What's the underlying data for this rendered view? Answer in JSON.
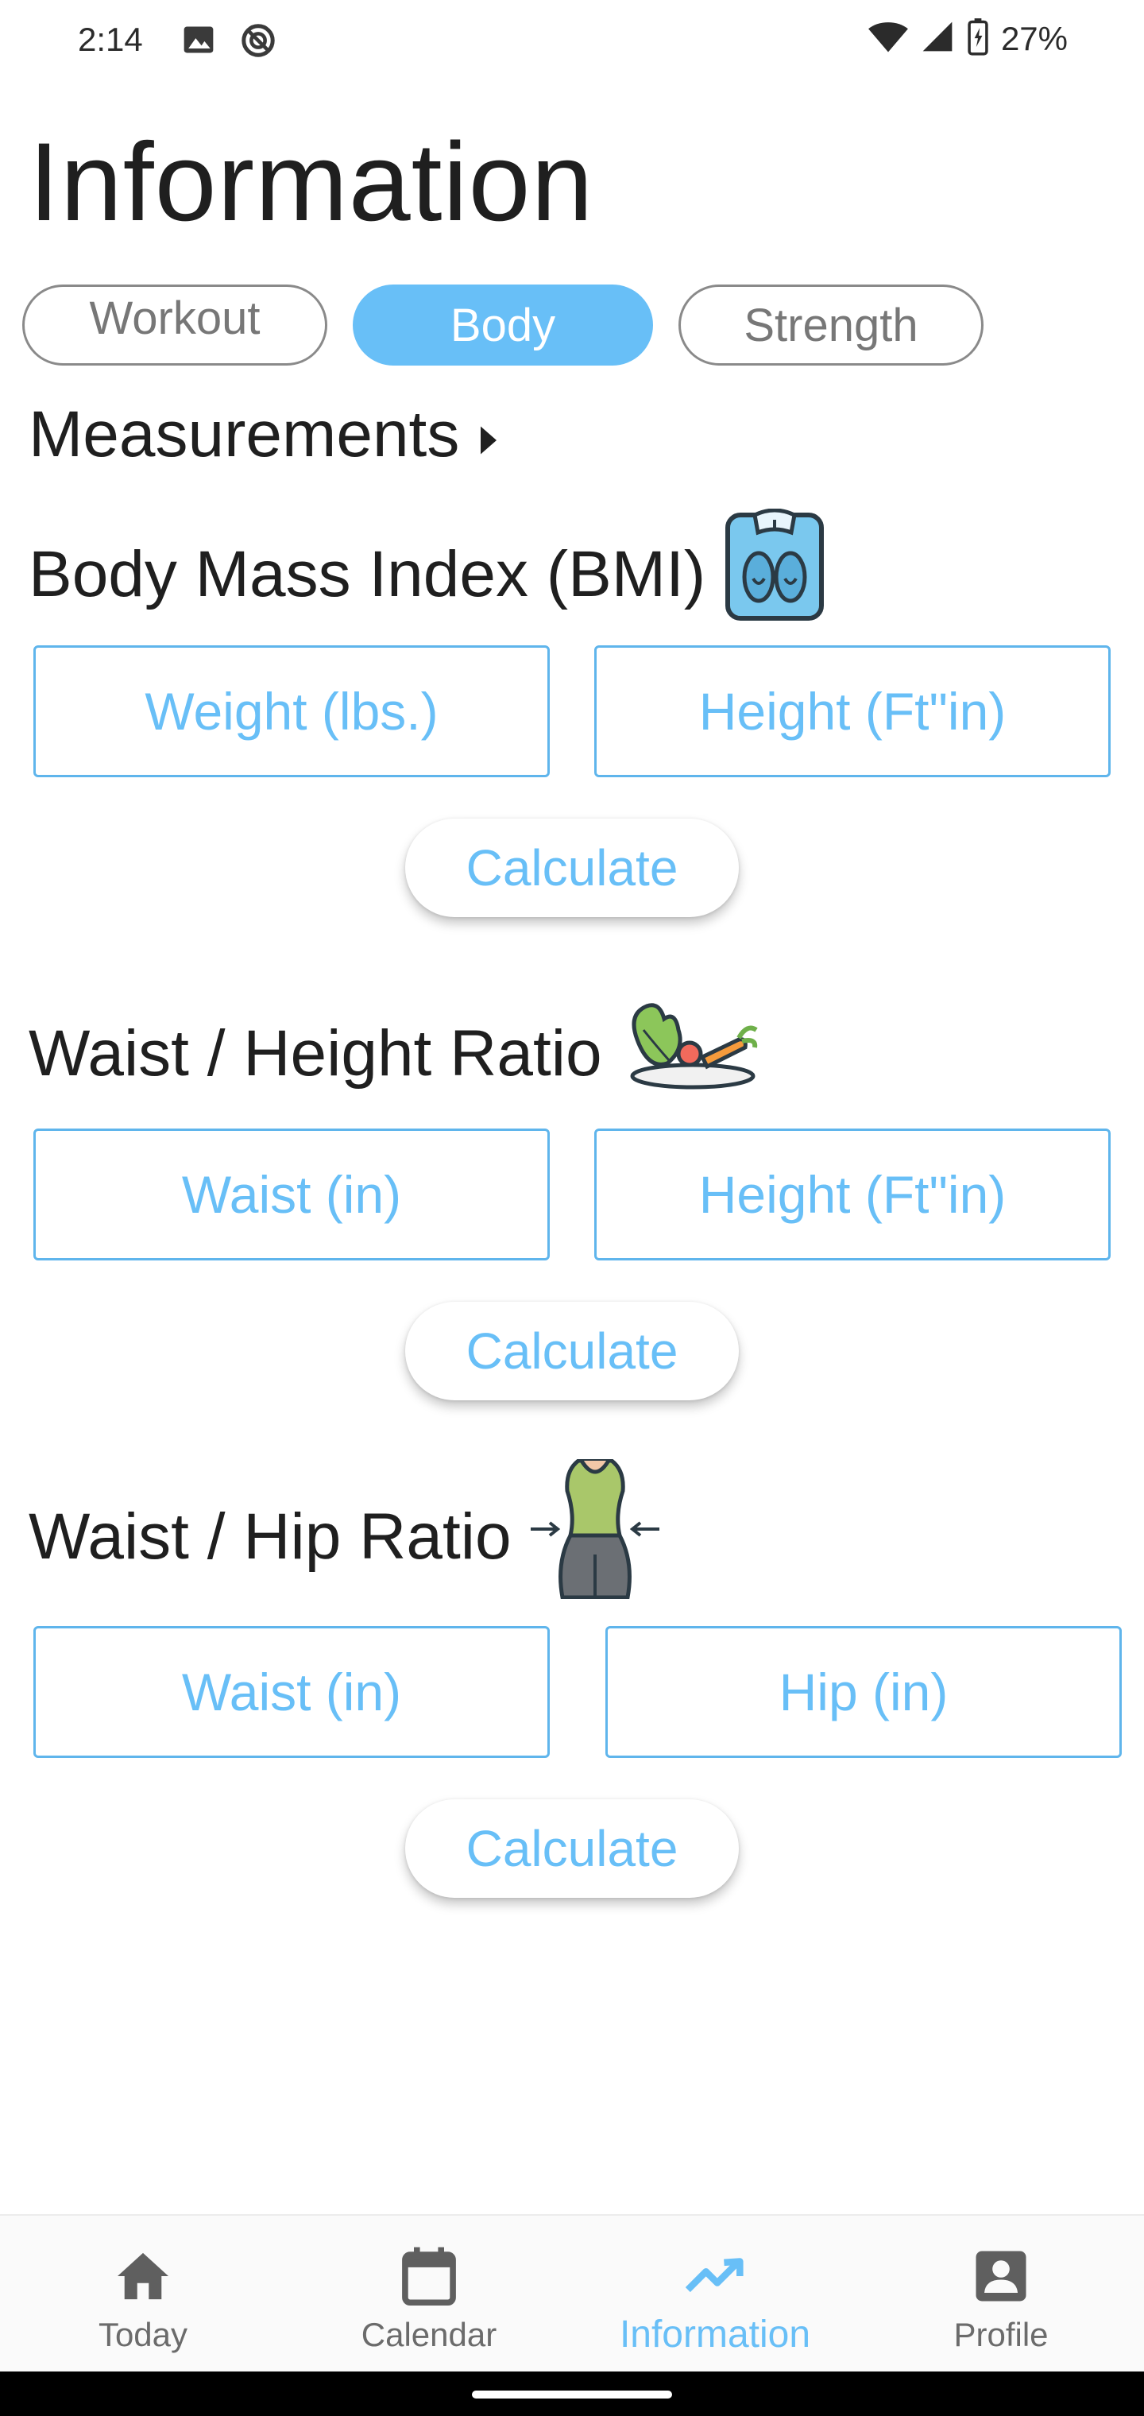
{
  "status_bar": {
    "time": "2:14",
    "battery": "27%",
    "icons": [
      "image-icon",
      "do-not-disturb-icon",
      "wifi-icon",
      "signal-icon",
      "battery-charging-icon"
    ]
  },
  "page": {
    "title": "Information"
  },
  "tabs": [
    {
      "label": "Workout",
      "active": false
    },
    {
      "label": "Body",
      "active": true
    },
    {
      "label": "Strength",
      "active": false
    }
  ],
  "measurements": {
    "label": "Measurements",
    "icon": "caret-right-icon"
  },
  "sections": {
    "bmi": {
      "title": "Body Mass Index (BMI)",
      "icon": "scale-icon",
      "fields": [
        {
          "placeholder": "Weight (lbs.)"
        },
        {
          "placeholder": "Height (Ft\"in)"
        }
      ],
      "button": "Calculate"
    },
    "waist_height": {
      "title": "Waist / Height Ratio",
      "icon": "salad-plate-icon",
      "fields": [
        {
          "placeholder": "Waist (in)"
        },
        {
          "placeholder": "Height (Ft\"in)"
        }
      ],
      "button": "Calculate"
    },
    "waist_hip": {
      "title": "Waist / Hip Ratio",
      "icon": "waist-torso-icon",
      "fields": [
        {
          "placeholder": "Waist (in)"
        },
        {
          "placeholder": "Hip (in)"
        }
      ],
      "button": "Calculate"
    }
  },
  "bottom_nav": [
    {
      "label": "Today",
      "icon": "home-icon",
      "active": false
    },
    {
      "label": "Calendar",
      "icon": "calendar-icon",
      "active": false
    },
    {
      "label": "Information",
      "icon": "trending-icon",
      "active": true
    },
    {
      "label": "Profile",
      "icon": "profile-icon",
      "active": false
    }
  ],
  "colors": {
    "accent": "#68bff7",
    "text": "#1f1f1f",
    "inactive": "#6b6b6b"
  }
}
